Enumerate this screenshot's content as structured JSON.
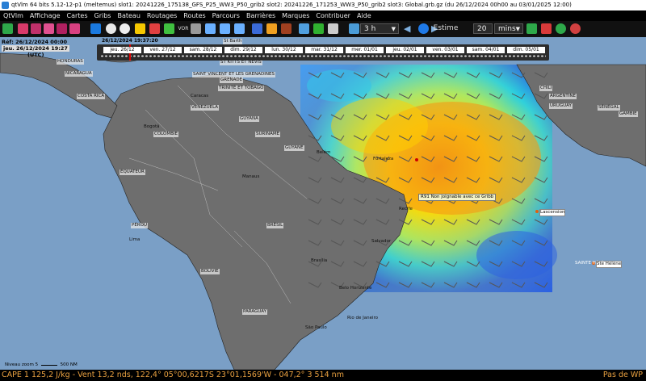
{
  "window_title": "qtVlm 64 bits 5.12-12-p1 (meltemus) slot1: 20241226_175138_GFS_P25_WW3_P50_grib2 slot2: 20241226_171253_WW3_P50_grib2 slot3: Global.grb.gz (du 26/12/2024 00h00 au 03/01/2025 12:00)",
  "menu": [
    "QtVlm",
    "Affichage",
    "Cartes",
    "Gribs",
    "Bateau",
    "Routages",
    "Routes",
    "Parcours",
    "Barrières",
    "Marques",
    "Contribuer",
    "Aide"
  ],
  "toolbar": {
    "vor_label": "VOR",
    "step_value": "3 h",
    "estime_label": "Estime",
    "minutes_value": "20",
    "unit_value": "mins",
    "icons": [
      "back-icon",
      "boat-o-icon",
      "wind-icon",
      "gust-icon",
      "current-icon",
      "wave-icon",
      "routing-icon",
      "compass-icon",
      "info-icon",
      "bulb-icon",
      "a13-icon",
      "a13b-icon",
      "vor-icon",
      "zoom-in-icon",
      "zoom-out-icon",
      "zoom-fit-icon",
      "grib-icon",
      "mark-icon",
      "arrow-icon",
      "grib-dl-icon",
      "refresh-icon",
      "settings-icon",
      "earth-icon",
      "prev-icon",
      "play-icon",
      "next-icon",
      "bell-icon",
      "record-icon",
      "sync-icon",
      "lifebuoy-icon"
    ]
  },
  "timeline": {
    "current_time": "26/12/2024 19:37:20",
    "days": [
      "jeu. 26/12",
      "ven. 27/12",
      "sam. 28/12",
      "dim. 29/12",
      "lun. 30/12",
      "mar. 31/12",
      "mer. 01/01",
      "jeu. 02/01",
      "ven. 03/01",
      "sam. 04/01",
      "dim. 05/01"
    ]
  },
  "ref_box": {
    "ref": "Réf: 26/12/2024 00:00",
    "now": "jeu. 26/12/2024 19:27",
    "tz": "(UTC)"
  },
  "map_labels": {
    "popup": "R91 Non joignable avec ce Gribb",
    "places": [
      {
        "name": "St Barth"
      },
      {
        "name": "ST KITTS ET NEVIS"
      },
      {
        "name": "SAINT VINCENT ET LES GRENADINES"
      },
      {
        "name": "GRENADE"
      },
      {
        "name": "TRINITÉ ET TOBAGO"
      },
      {
        "name": "HONDURAS"
      },
      {
        "name": "NICARAGUA"
      },
      {
        "name": "COSTA RICA"
      },
      {
        "name": "VENEZUELA"
      },
      {
        "name": "GUYANA"
      },
      {
        "name": "SURINAME"
      },
      {
        "name": "GUYANE"
      },
      {
        "name": "COLOMBIE"
      },
      {
        "name": "ÉQUATEUR"
      },
      {
        "name": "PÉROU"
      },
      {
        "name": "BOLIVIE"
      },
      {
        "name": "BRÉSIL"
      },
      {
        "name": "PARAGUAY"
      },
      {
        "name": "CHILI"
      },
      {
        "name": "ARGENTINE"
      },
      {
        "name": "URUGUAY"
      },
      {
        "name": "SÉNÉGAL"
      },
      {
        "name": "GAMBIE"
      },
      {
        "name": "GUINÉE"
      },
      {
        "name": "CÔTE D'IVOIRE"
      },
      {
        "name": "GHANA"
      },
      {
        "name": "NIGERIA"
      },
      {
        "name": "LIBERIA"
      },
      {
        "name": "TOGO"
      },
      {
        "name": "Lascension"
      },
      {
        "name": "SAINTE HÉLÈNE"
      },
      {
        "name": "Ste Hélène"
      },
      {
        "name": "Fortaleza"
      },
      {
        "name": "Recife"
      },
      {
        "name": "Salvador"
      },
      {
        "name": "Brasília"
      },
      {
        "name": "Belo Horizonte"
      },
      {
        "name": "Rio de Janeiro"
      },
      {
        "name": "São Paulo"
      },
      {
        "name": "Manaus"
      },
      {
        "name": "Belém"
      },
      {
        "name": "Bogotá"
      },
      {
        "name": "Caracas"
      },
      {
        "name": "Lima"
      }
    ]
  },
  "scale": {
    "zoom": "Niveau zoom 5",
    "distance": "500 NM"
  },
  "status": {
    "left": "CAPE 1 125,2 J/kg - Vent 13,2 nds, 122,4° 05°00,6217S 23°01,1569'W - 047,2° 3 514 nm",
    "right": "Pas de WP"
  },
  "colors": {
    "sea": "#7a9fc6",
    "land": "#6e6e6e",
    "status_text": "#e8a040",
    "menu_bg": "#000000"
  }
}
